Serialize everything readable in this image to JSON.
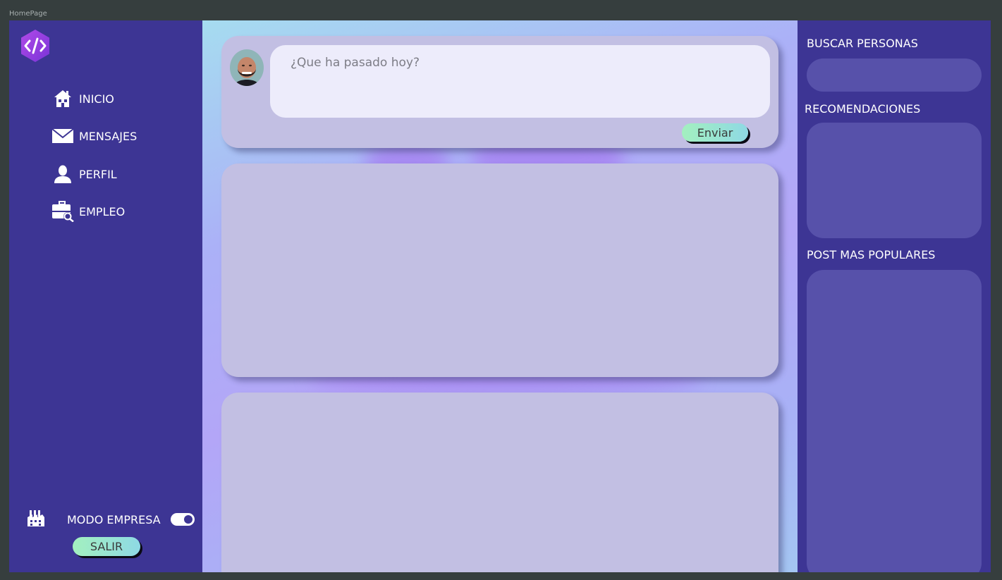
{
  "window": {
    "title": "HomePage"
  },
  "sidebar": {
    "logo": "code-logo-icon",
    "items": [
      {
        "label": "INICIO",
        "icon": "home-icon"
      },
      {
        "label": "MENSAJES",
        "icon": "envelope-icon"
      },
      {
        "label": "PERFIL",
        "icon": "user-icon"
      },
      {
        "label": "EMPLEO",
        "icon": "briefcase-search-icon"
      }
    ],
    "modo_empresa": {
      "label": "MODO EMPRESA",
      "icon": "factory-icon",
      "enabled": true
    },
    "salir_label": "SALIR"
  },
  "composer": {
    "placeholder": "¿Que ha pasado hoy?",
    "submit_label": "Enviar"
  },
  "rightbar": {
    "search_title": "BUSCAR PERSONAS",
    "recommendations_title": "RECOMENDACIONES",
    "popular_title": "POST MAS POPULARES"
  },
  "colors": {
    "sidebar_bg": "#3d3594",
    "panel_bg": "#5751aa",
    "card_bg": "#c2bfe3",
    "button_gradient_start": "#a3f0bf",
    "button_gradient_end": "#8ed9e4",
    "logo_purple": "#9b3fe0"
  }
}
